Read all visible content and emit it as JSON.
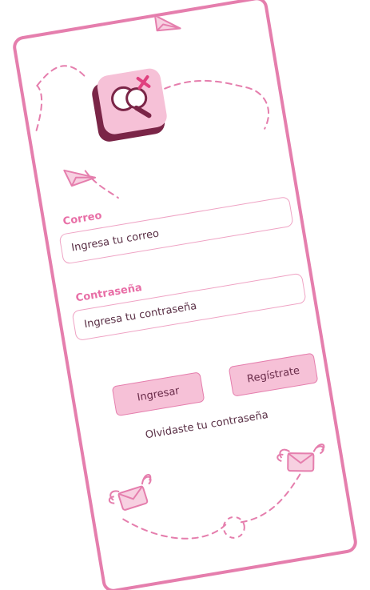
{
  "app": {
    "accent_color": "#e57ead",
    "button_color": "#f6c1d7",
    "logo_icon": "search-heart-app-icon"
  },
  "email": {
    "label": "Correo",
    "placeholder": "Ingresa tu correo"
  },
  "password": {
    "label": "Contraseña",
    "placeholder": "Ingresa tu contraseña"
  },
  "actions": {
    "login_label": "Ingresar",
    "register_label": "Regístrate",
    "forgot_label": "Olvidaste tu contraseña"
  },
  "decorations": [
    "paper-plane-icon",
    "paper-plane-icon",
    "flying-envelope-icon",
    "flying-envelope-icon"
  ]
}
